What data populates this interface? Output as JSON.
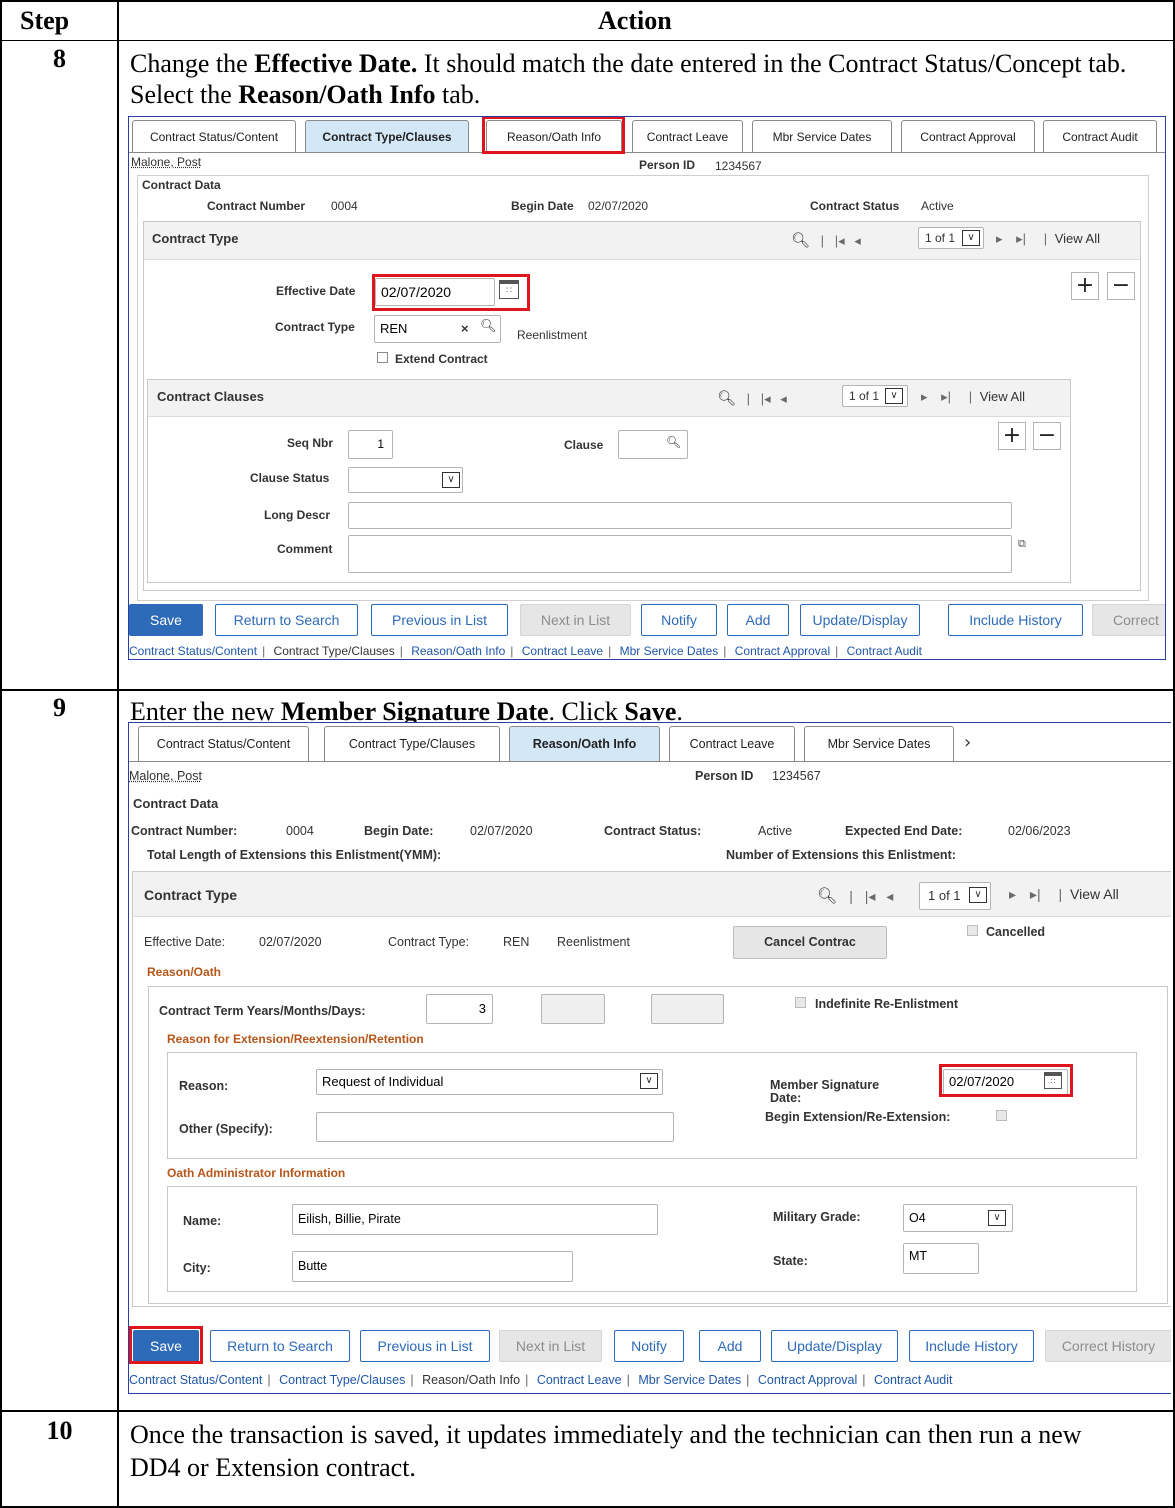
{
  "table": {
    "col_step": "Step",
    "col_action": "Action"
  },
  "step8": {
    "num": "8",
    "instr": {
      "p1": "Change the ",
      "b1": "Effective Date.",
      "p2": " It should match the date entered in the Contract Status/Concept tab. Select the ",
      "b2": "Reason/Oath Info",
      "p3": " tab."
    },
    "tabs": [
      "Contract Status/Content",
      "Contract Type/Clauses",
      "Reason/Oath Info",
      "Contract Leave",
      "Mbr Service Dates",
      "Contract Approval",
      "Contract Audit"
    ],
    "person_name": "Malone, Post",
    "person_id_label": "Person ID",
    "person_id": "1234567",
    "section": "Contract Data",
    "contract_number_label": "Contract Number",
    "contract_number": "0004",
    "begin_date_label": "Begin Date",
    "begin_date": "02/07/2020",
    "status_label": "Contract Status",
    "status": "Active",
    "group_title": "Contract Type",
    "nav": {
      "count": "1 of 1",
      "view_all": "View All"
    },
    "effective_date_label": "Effective Date",
    "effective_date": "02/07/2020",
    "contract_type_label": "Contract Type",
    "contract_type": "REN",
    "contract_type_desc": "Reenlistment",
    "extend_label": "Extend Contract",
    "clauses": {
      "title": "Contract Clauses",
      "count": "1 of 1",
      "view_all": "View All",
      "seq_label": "Seq Nbr",
      "seq": "1",
      "clause_label": "Clause",
      "clause_status_label": "Clause Status",
      "long_descr_label": "Long Descr",
      "comment_label": "Comment"
    },
    "buttons": [
      "Save",
      "Return to Search",
      "Previous in List",
      "Next in List",
      "Notify",
      "Add",
      "Update/Display",
      "Include History",
      "Correct"
    ],
    "links": [
      "Contract Status/Content",
      "Contract Type/Clauses",
      "Reason/Oath Info",
      "Contract Leave",
      "Mbr Service Dates",
      "Contract Approval",
      "Contract Audit"
    ]
  },
  "step9": {
    "num": "9",
    "instr": {
      "p1": "Enter the new ",
      "b1": "Member Signature Date",
      "p2": ". Click ",
      "b2": "Save",
      "p3": "."
    },
    "tabs": [
      "Contract Status/Content",
      "Contract Type/Clauses",
      "Reason/Oath Info",
      "Contract Leave",
      "Mbr Service Dates"
    ],
    "person_name": "Malone, Post",
    "person_id_label": "Person ID",
    "person_id": "1234567",
    "section": "Contract Data",
    "contract_number_label": "Contract Number:",
    "contract_number": "0004",
    "begin_date_label": "Begin Date:",
    "begin_date": "02/07/2020",
    "status_label": "Contract Status:",
    "status": "Active",
    "end_date_label": "Expected End Date:",
    "end_date": "02/06/2023",
    "total_ext_label": "Total Length of Extensions this Enlistment(YMM):",
    "num_ext_label": "Number of Extensions this Enlistment:",
    "group_title": "Contract Type",
    "nav": {
      "count": "1 of 1",
      "view_all": "View All"
    },
    "eff_label": "Effective Date:",
    "eff": "02/07/2020",
    "ct_label": "Contract Type:",
    "ct": "REN",
    "ct_desc": "Reenlistment",
    "cancel_btn": "Cancel Contrac",
    "cancelled_label": "Cancelled",
    "reason_oath": "Reason/Oath",
    "term_label": "Contract Term Years/Months/Days:",
    "term_years": "3",
    "indef_label": "Indefinite Re-Enlistment",
    "reason_group": "Reason for Extension/Reextension/Retention",
    "reason_label": "Reason:",
    "reason": "Request of Individual",
    "sig_label": "Member Signature Date:",
    "sig_date": "02/07/2020",
    "begin_ext_label": "Begin Extension/Re-Extension:",
    "other_label": "Other (Specify):",
    "oath_group": "Oath Administrator Information",
    "name_label": "Name:",
    "name": "Eilish, Billie, Pirate",
    "grade_label": "Military Grade:",
    "grade": "O4",
    "city_label": "City:",
    "city": "Butte",
    "state_label": "State:",
    "state": "MT",
    "buttons": [
      "Save",
      "Return to Search",
      "Previous in List",
      "Next in List",
      "Notify",
      "Add",
      "Update/Display",
      "Include History",
      "Correct History"
    ],
    "links": [
      "Contract Status/Content",
      "Contract Type/Clauses",
      "Reason/Oath Info",
      "Contract Leave",
      "Mbr Service Dates",
      "Contract Approval",
      "Contract Audit"
    ]
  },
  "step10": {
    "num": "10",
    "text": "Once the transaction is saved, it updates immediately and the technician can then run a new DD4 or Extension contract."
  },
  "colors": {
    "accent": "#2d6ab7",
    "highlight": "#e0141c",
    "tab_selected": "#d4e7f7",
    "section_orange": "#b5561a"
  },
  "icons": [
    "search-icon",
    "calendar-icon",
    "clear-icon",
    "dropdown-icon",
    "first-page-icon",
    "prev-page-icon",
    "next-page-icon",
    "last-page-icon",
    "add-row-icon",
    "delete-row-icon",
    "expand-icon",
    "chevron-right-icon"
  ]
}
